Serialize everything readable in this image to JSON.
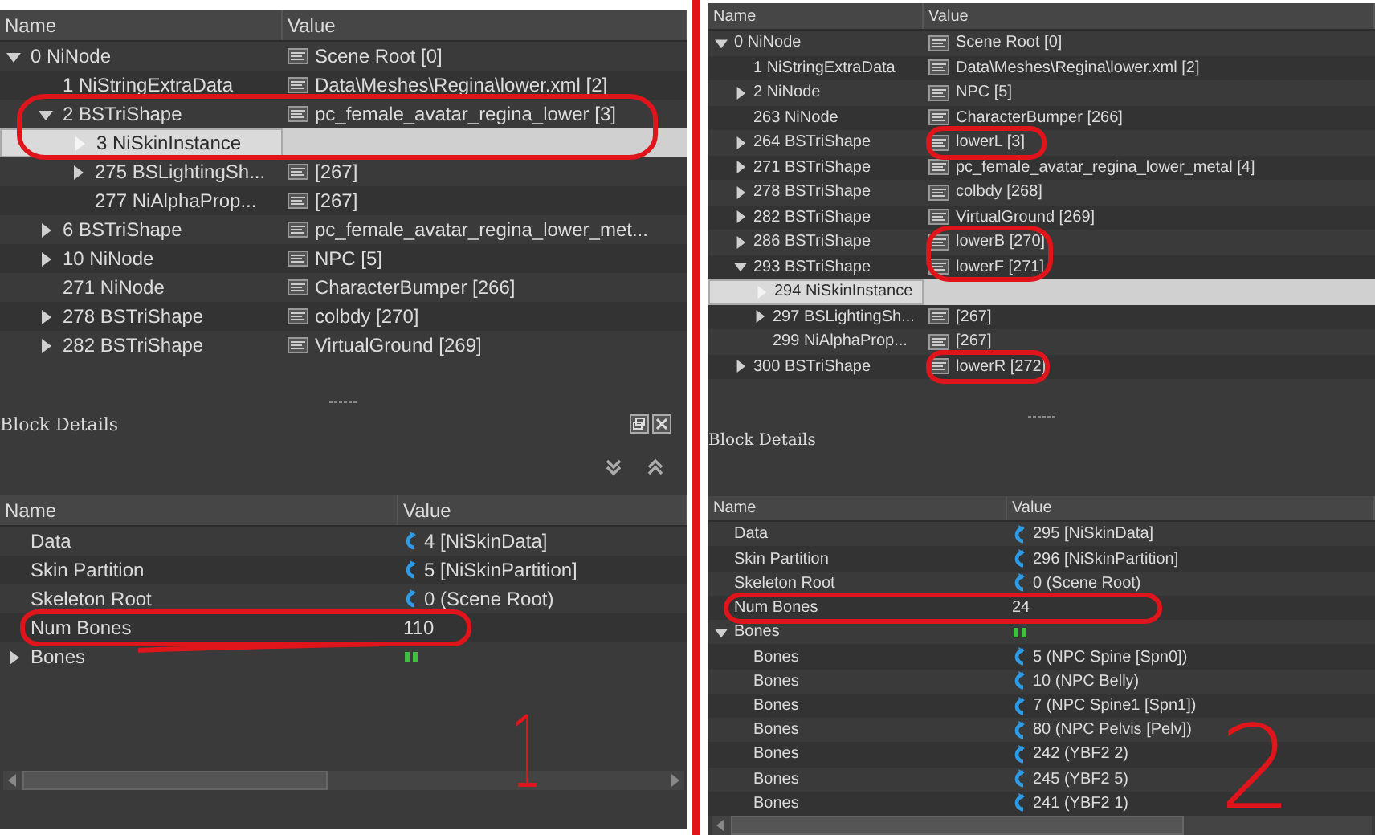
{
  "panels": [
    {
      "annotation_number": "1",
      "tree": {
        "columns": [
          "Name",
          "Value"
        ],
        "rows": [
          {
            "name": "0 NiNode",
            "value": "Scene Root [0]",
            "kind": "text",
            "expanded": true,
            "selected": false,
            "children": [
              {
                "name": "1 NiStringExtraData",
                "value": "Data\\Meshes\\Regina\\lower.xml [2]",
                "kind": "text",
                "selected": false
              },
              {
                "name": "2 BSTriShape",
                "value": "pc_female_avatar_regina_lower [3]",
                "kind": "text",
                "expanded": true,
                "selected": false,
                "children": [
                  {
                    "name": "3 NiSkinInstance",
                    "expanded": false,
                    "selected": true
                  },
                  {
                    "name": "275 BSLightingSh...",
                    "value": "[267]",
                    "kind": "text",
                    "expanded": false,
                    "selected": false
                  },
                  {
                    "name": "277 NiAlphaProp...",
                    "value": "[267]",
                    "kind": "text",
                    "selected": false
                  }
                ]
              },
              {
                "name": "6 BSTriShape",
                "value": "pc_female_avatar_regina_lower_met...",
                "kind": "text",
                "expanded": false,
                "selected": false
              },
              {
                "name": "10 NiNode",
                "value": "NPC [5]",
                "kind": "text",
                "expanded": false,
                "selected": false
              },
              {
                "name": "271 NiNode",
                "value": "CharacterBumper [266]",
                "kind": "text",
                "selected": false
              },
              {
                "name": "278 BSTriShape",
                "value": "colbdy [270]",
                "kind": "text",
                "expanded": false,
                "selected": false
              },
              {
                "name": "282 BSTriShape",
                "value": "VirtualGround [269]",
                "kind": "text",
                "expanded": false,
                "selected": false
              }
            ]
          }
        ]
      },
      "details": {
        "title": "Block Details",
        "columns": [
          "Name",
          "Value"
        ],
        "rows": [
          {
            "name": "Data",
            "value": "4 [NiSkinData]",
            "kind": "ref"
          },
          {
            "name": "Skin Partition",
            "value": "5 [NiSkinPartition]",
            "kind": "ref"
          },
          {
            "name": "Skeleton Root",
            "value": "0 (Scene Root)",
            "kind": "ref"
          },
          {
            "name": "Num Bones",
            "value": "110",
            "kind": "plain"
          },
          {
            "name": "Bones",
            "kind": "array",
            "expanded": false
          }
        ]
      }
    },
    {
      "annotation_number": "2",
      "tree": {
        "columns": [
          "Name",
          "Value"
        ],
        "rows": [
          {
            "name": "0 NiNode",
            "value": "Scene Root [0]",
            "kind": "text",
            "expanded": true,
            "selected": false,
            "children": [
              {
                "name": "1 NiStringExtraData",
                "value": "Data\\Meshes\\Regina\\lower.xml [2]",
                "kind": "text",
                "selected": false
              },
              {
                "name": "2 NiNode",
                "value": "NPC [5]",
                "kind": "text",
                "expanded": false,
                "selected": false
              },
              {
                "name": "263 NiNode",
                "value": "CharacterBumper [266]",
                "kind": "text",
                "selected": false
              },
              {
                "name": "264 BSTriShape",
                "value": "lowerL [3]",
                "kind": "text",
                "expanded": false,
                "selected": false
              },
              {
                "name": "271 BSTriShape",
                "value": "pc_female_avatar_regina_lower_metal [4]",
                "kind": "text",
                "expanded": false,
                "selected": false
              },
              {
                "name": "278 BSTriShape",
                "value": "colbdy [268]",
                "kind": "text",
                "expanded": false,
                "selected": false
              },
              {
                "name": "282 BSTriShape",
                "value": "VirtualGround [269]",
                "kind": "text",
                "expanded": false,
                "selected": false
              },
              {
                "name": "286 BSTriShape",
                "value": "lowerB [270]",
                "kind": "text",
                "expanded": false,
                "selected": false
              },
              {
                "name": "293 BSTriShape",
                "value": "lowerF [271]",
                "kind": "text",
                "expanded": true,
                "selected": false,
                "children": [
                  {
                    "name": "294 NiSkinInstance",
                    "expanded": false,
                    "selected": true
                  },
                  {
                    "name": "297 BSLightingSh...",
                    "value": "[267]",
                    "kind": "text",
                    "expanded": false,
                    "selected": false
                  },
                  {
                    "name": "299 NiAlphaProp...",
                    "value": "[267]",
                    "kind": "text",
                    "selected": false
                  }
                ]
              },
              {
                "name": "300 BSTriShape",
                "value": "lowerR [272]",
                "kind": "text",
                "expanded": false,
                "selected": false
              }
            ]
          }
        ]
      },
      "details": {
        "title": "Block Details",
        "columns": [
          "Name",
          "Value"
        ],
        "rows": [
          {
            "name": "Data",
            "value": "295 [NiSkinData]",
            "kind": "ref"
          },
          {
            "name": "Skin Partition",
            "value": "296 [NiSkinPartition]",
            "kind": "ref"
          },
          {
            "name": "Skeleton Root",
            "value": "0 (Scene Root)",
            "kind": "ref"
          },
          {
            "name": "Num Bones",
            "value": "24",
            "kind": "plain"
          },
          {
            "name": "Bones",
            "kind": "array",
            "expanded": true,
            "children": [
              {
                "name": "Bones",
                "value": "5 (NPC Spine [Spn0])",
                "kind": "ref"
              },
              {
                "name": "Bones",
                "value": "10 (NPC Belly)",
                "kind": "ref"
              },
              {
                "name": "Bones",
                "value": "7 (NPC Spine1 [Spn1])",
                "kind": "ref"
              },
              {
                "name": "Bones",
                "value": "80 (NPC Pelvis [Pelv])",
                "kind": "ref"
              },
              {
                "name": "Bones",
                "value": "242 (YBF2 2)",
                "kind": "ref"
              },
              {
                "name": "Bones",
                "value": "245 (YBF2 5)",
                "kind": "ref"
              },
              {
                "name": "Bones",
                "value": "241 (YBF2 1)",
                "kind": "ref"
              }
            ]
          }
        ]
      }
    }
  ]
}
